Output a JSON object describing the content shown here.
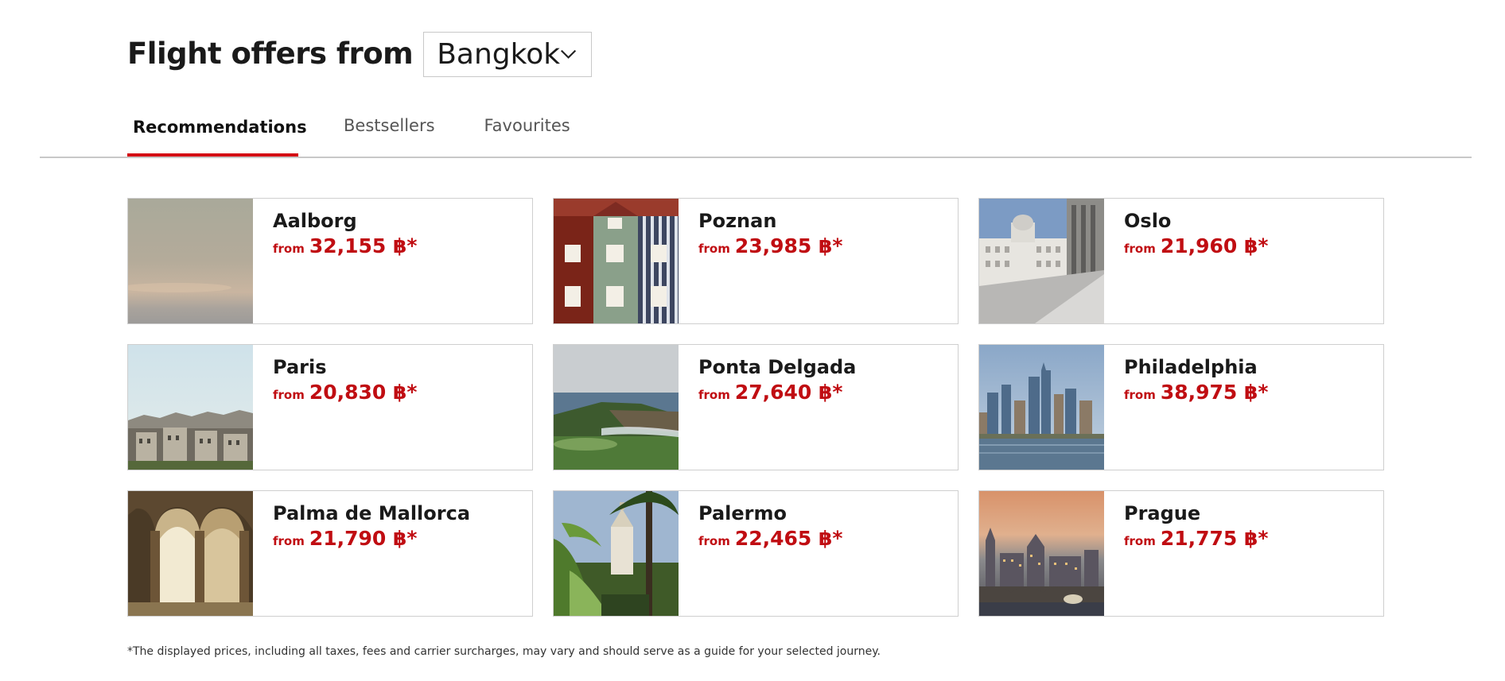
{
  "header": {
    "title": "Flight offers from",
    "origin_select": {
      "value": "Bangkok",
      "icon": "chevron-down-icon"
    }
  },
  "tabs": [
    {
      "label": "Recommendations",
      "active": true
    },
    {
      "label": "Bestsellers",
      "active": false
    },
    {
      "label": "Favourites",
      "active": false
    }
  ],
  "colors": {
    "accent_red": "#d40e14",
    "price_red": "#c00d12",
    "border_gray": "#cfcfcf"
  },
  "offers": [
    {
      "city": "Aalborg",
      "from_label": "from",
      "price": "32,155 ฿*",
      "image": "aalborg-sky-photo"
    },
    {
      "city": "Poznan",
      "from_label": "from",
      "price": "23,985 ฿*",
      "image": "poznan-colorful-houses-photo"
    },
    {
      "city": "Oslo",
      "from_label": "from",
      "price": "21,960 ฿*",
      "image": "oslo-building-photo"
    },
    {
      "city": "Paris",
      "from_label": "from",
      "price": "20,830 ฿*",
      "image": "paris-rooftops-photo"
    },
    {
      "city": "Ponta Delgada",
      "from_label": "from",
      "price": "27,640 ฿*",
      "image": "ponta-delgada-coast-photo"
    },
    {
      "city": "Philadelphia",
      "from_label": "from",
      "price": "38,975 ฿*",
      "image": "philadelphia-skyline-photo"
    },
    {
      "city": "Palma de Mallorca",
      "from_label": "from",
      "price": "21,790 ฿*",
      "image": "palma-arches-photo"
    },
    {
      "city": "Palermo",
      "from_label": "from",
      "price": "22,465 ฿*",
      "image": "palermo-palm-garden-photo"
    },
    {
      "city": "Prague",
      "from_label": "from",
      "price": "21,775 ฿*",
      "image": "prague-bridge-photo"
    }
  ],
  "footnote": "*The displayed prices, including all taxes, fees and carrier surcharges, may vary and should serve as a guide for your selected journey."
}
